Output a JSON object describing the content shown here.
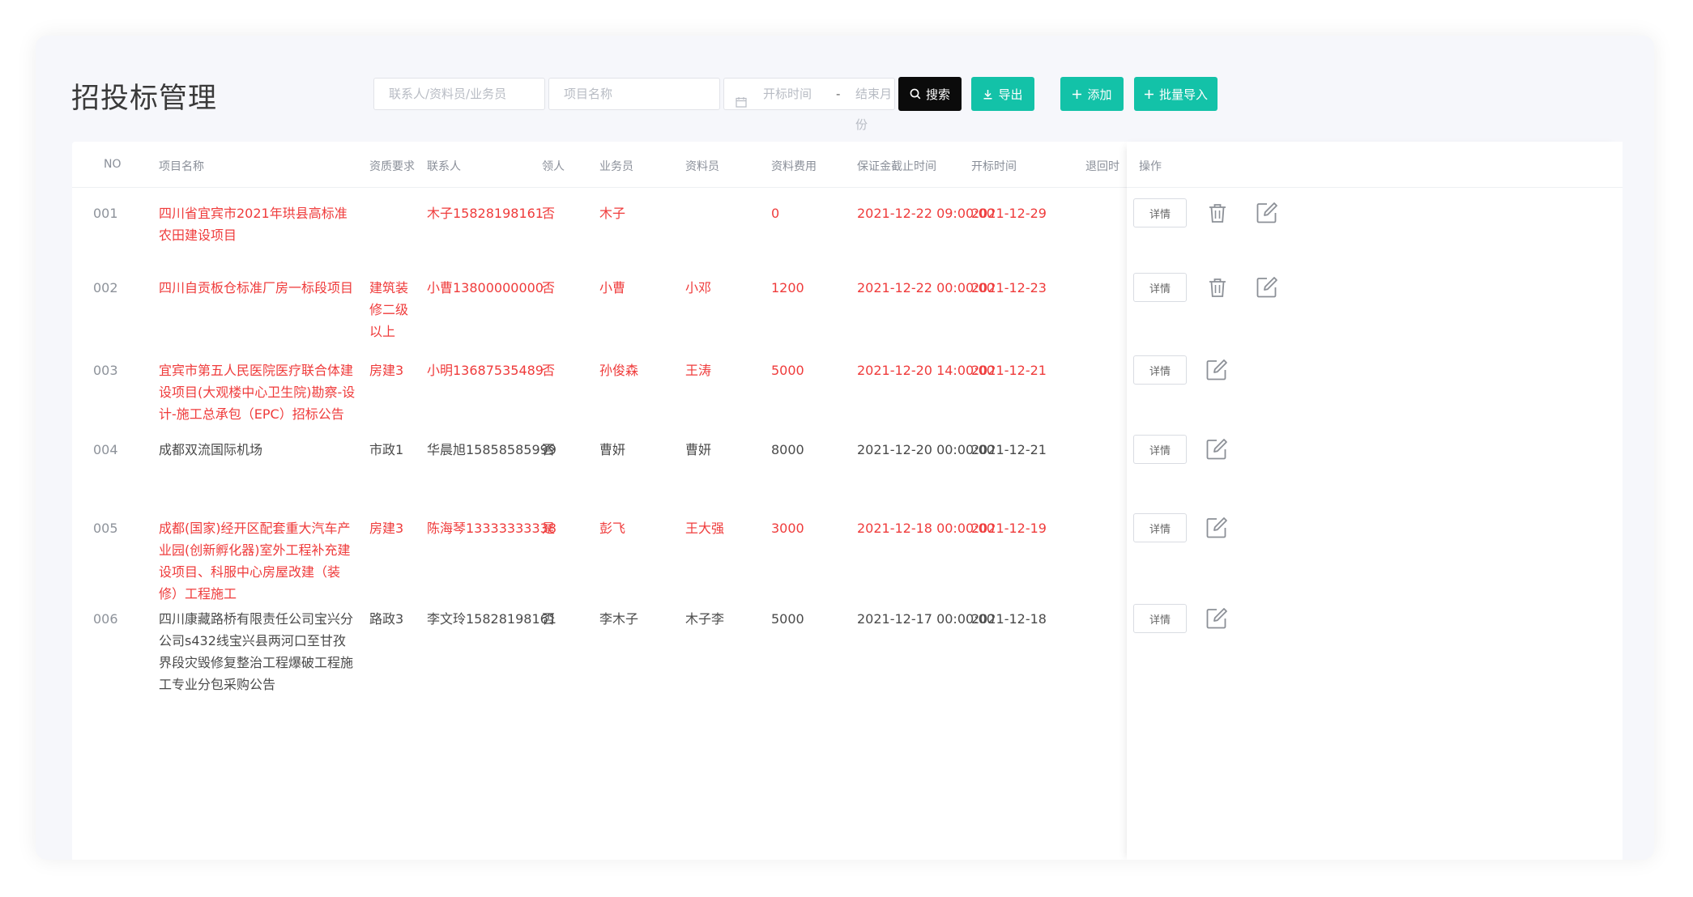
{
  "page": {
    "title": "招投标管理"
  },
  "filters": {
    "contact_placeholder": "联系人/资料员/业务员",
    "project_placeholder": "项目名称",
    "date_start_placeholder": "开标时间",
    "date_separator": "-",
    "date_end_placeholder": "结束月份"
  },
  "toolbar": {
    "search_label": "搜索",
    "export_label": "导出",
    "add_label": "添加",
    "import_label": "批量导入"
  },
  "table": {
    "headers": {
      "no": "NO",
      "project": "项目名称",
      "qualification": "资质要求",
      "contact": "联系人",
      "received": "领人",
      "salesman": "业务员",
      "clerk": "资料员",
      "fee": "资料费用",
      "deposit_deadline": "保证金截止时间",
      "open_time": "开标时间",
      "refund_time": "退回时",
      "actions": "操作"
    },
    "detail_label": "详情",
    "rows": [
      {
        "no": "001",
        "project": "四川省宜宾市2021年珙县高标准农田建设项目",
        "qualification": "",
        "contact": "木子15828198161",
        "received": "否",
        "salesman": "木子",
        "clerk": "",
        "fee": "0",
        "deposit_deadline": "2021-12-22 09:00:00",
        "open_time": "2021-12-29",
        "highlight": true,
        "deletable": true
      },
      {
        "no": "002",
        "project": "四川自贡板仓标准厂房一标段项目",
        "qualification": "建筑装修二级以上",
        "contact": "小曹13800000000",
        "received": "否",
        "salesman": "小曹",
        "clerk": "小邓",
        "fee": "1200",
        "deposit_deadline": "2021-12-22 00:00:00",
        "open_time": "2021-12-23",
        "highlight": true,
        "deletable": true
      },
      {
        "no": "003",
        "project": "宜宾市第五人民医院医疗联合体建设项目(大观楼中心卫生院)勘察-设计-施工总承包（EPC）招标公告",
        "qualification": "房建3",
        "contact": "小明13687535489",
        "received": "否",
        "salesman": "孙俊森",
        "clerk": "王涛",
        "fee": "5000",
        "deposit_deadline": "2021-12-20 14:00:00",
        "open_time": "2021-12-21",
        "highlight": true,
        "deletable": false
      },
      {
        "no": "004",
        "project": "成都双流国际机场",
        "qualification": "市政1",
        "contact": "华晨旭15858585999",
        "received": "否",
        "salesman": "曹妍",
        "clerk": "曹妍",
        "fee": "8000",
        "deposit_deadline": "2021-12-20 00:00:00",
        "open_time": "2021-12-21",
        "highlight": false,
        "deletable": false
      },
      {
        "no": "005",
        "project": "成都(国家)经开区配套重大汽车产业园(创新孵化器)室外工程补充建设项目、科服中心房屋改建（装修）工程施工",
        "qualification": "房建3",
        "contact": "陈海琴13333333338",
        "received": "是",
        "salesman": "彭飞",
        "clerk": "王大强",
        "fee": "3000",
        "deposit_deadline": "2021-12-18 00:00:00",
        "open_time": "2021-12-19",
        "highlight": true,
        "deletable": false
      },
      {
        "no": "006",
        "project": "四川康藏路桥有限责任公司宝兴分公司s432线宝兴县两河口至甘孜界段灾毁修复整治工程爆破工程施工专业分包采购公告",
        "qualification": "路政3",
        "contact": "李文玲15828198161",
        "received": "否",
        "salesman": "李木子",
        "clerk": "木子李",
        "fee": "5000",
        "deposit_deadline": "2021-12-17 00:00:00",
        "open_time": "2021-12-18",
        "highlight": false,
        "deletable": false
      }
    ]
  },
  "colors": {
    "highlight": "#ef3b3b",
    "normal": "#4a4a4a",
    "accent": "#13c2a8",
    "dark_button": "#0b0b0b"
  }
}
